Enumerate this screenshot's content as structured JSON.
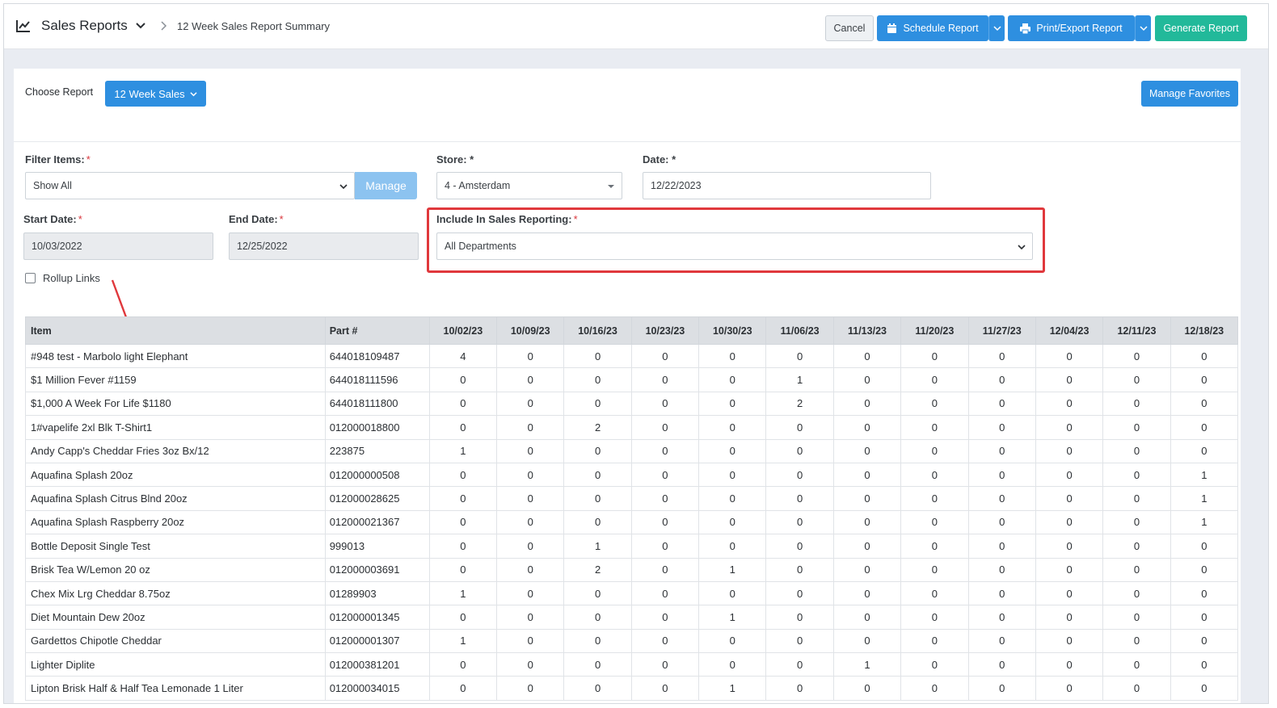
{
  "header": {
    "app_title": "Sales Reports",
    "breadcrumb": "12 Week Sales Report Summary",
    "cancel_label": "Cancel",
    "schedule_label": "Schedule Report",
    "print_label": "Print/Export Report",
    "generate_label": "Generate Report"
  },
  "report_picker": {
    "label": "Choose Report",
    "selected": "12 Week Sales",
    "favorites_label": "Manage Favorites"
  },
  "filters": {
    "filter_items_label": "Filter Items:",
    "filter_items_value": "Show All",
    "manage_label": "Manage",
    "store_label": "Store: *",
    "store_value": "4 - Amsterdam",
    "date_label": "Date: *",
    "date_value": "12/22/2023",
    "start_date_label": "Start Date:",
    "start_date_value": "10/03/2022",
    "end_date_label": "End Date:",
    "end_date_value": "12/25/2022",
    "include_label": "Include In Sales Reporting:",
    "include_value": "All Departments",
    "required_mark": "*",
    "rollup_label": "Rollup Links"
  },
  "table": {
    "columns": [
      "Item",
      "Part #",
      "10/02/23",
      "10/09/23",
      "10/16/23",
      "10/23/23",
      "10/30/23",
      "11/06/23",
      "11/13/23",
      "11/20/23",
      "11/27/23",
      "12/04/23",
      "12/11/23",
      "12/18/23"
    ],
    "rows": [
      [
        "#948 test - Marbolo light Elephant",
        "644018109487",
        "4",
        "0",
        "0",
        "0",
        "0",
        "0",
        "0",
        "0",
        "0",
        "0",
        "0",
        "0"
      ],
      [
        "$1 Million Fever #1159",
        "644018111596",
        "0",
        "0",
        "0",
        "0",
        "0",
        "1",
        "0",
        "0",
        "0",
        "0",
        "0",
        "0"
      ],
      [
        "$1,000 A Week For Life $1180",
        "644018111800",
        "0",
        "0",
        "0",
        "0",
        "0",
        "2",
        "0",
        "0",
        "0",
        "0",
        "0",
        "0"
      ],
      [
        "1#vapelife 2xl Blk T-Shirt1",
        "012000018800",
        "0",
        "0",
        "2",
        "0",
        "0",
        "0",
        "0",
        "0",
        "0",
        "0",
        "0",
        "0"
      ],
      [
        "Andy Capp's Cheddar Fries 3oz Bx/12",
        "223875",
        "1",
        "0",
        "0",
        "0",
        "0",
        "0",
        "0",
        "0",
        "0",
        "0",
        "0",
        "0"
      ],
      [
        "Aquafina Splash 20oz",
        "012000000508",
        "0",
        "0",
        "0",
        "0",
        "0",
        "0",
        "0",
        "0",
        "0",
        "0",
        "0",
        "1"
      ],
      [
        "Aquafina Splash Citrus Blnd 20oz",
        "012000028625",
        "0",
        "0",
        "0",
        "0",
        "0",
        "0",
        "0",
        "0",
        "0",
        "0",
        "0",
        "1"
      ],
      [
        "Aquafina Splash Raspberry 20oz",
        "012000021367",
        "0",
        "0",
        "0",
        "0",
        "0",
        "0",
        "0",
        "0",
        "0",
        "0",
        "0",
        "1"
      ],
      [
        "Bottle Deposit Single Test",
        "999013",
        "0",
        "0",
        "1",
        "0",
        "0",
        "0",
        "0",
        "0",
        "0",
        "0",
        "0",
        "0"
      ],
      [
        "Brisk Tea W/Lemon 20 oz",
        "012000003691",
        "0",
        "0",
        "2",
        "0",
        "1",
        "0",
        "0",
        "0",
        "0",
        "0",
        "0",
        "0"
      ],
      [
        "Chex Mix Lrg Cheddar 8.75oz",
        "01289903",
        "1",
        "0",
        "0",
        "0",
        "0",
        "0",
        "0",
        "0",
        "0",
        "0",
        "0",
        "0"
      ],
      [
        "Diet Mountain Dew 20oz",
        "012000001345",
        "0",
        "0",
        "0",
        "0",
        "1",
        "0",
        "0",
        "0",
        "0",
        "0",
        "0",
        "0"
      ],
      [
        "Gardettos Chipotle Cheddar",
        "012000001307",
        "1",
        "0",
        "0",
        "0",
        "0",
        "0",
        "0",
        "0",
        "0",
        "0",
        "0",
        "0"
      ],
      [
        "Lighter Diplite",
        "012000381201",
        "0",
        "0",
        "0",
        "0",
        "0",
        "0",
        "1",
        "0",
        "0",
        "0",
        "0",
        "0"
      ],
      [
        "Lipton Brisk Half & Half Tea Lemonade 1 Liter",
        "012000034015",
        "0",
        "0",
        "0",
        "0",
        "1",
        "0",
        "0",
        "0",
        "0",
        "0",
        "0",
        "0"
      ]
    ]
  },
  "colors": {
    "primary": "#2e8fe0",
    "success": "#22b99a",
    "highlight": "#e0383c",
    "required": "#d9353b"
  }
}
